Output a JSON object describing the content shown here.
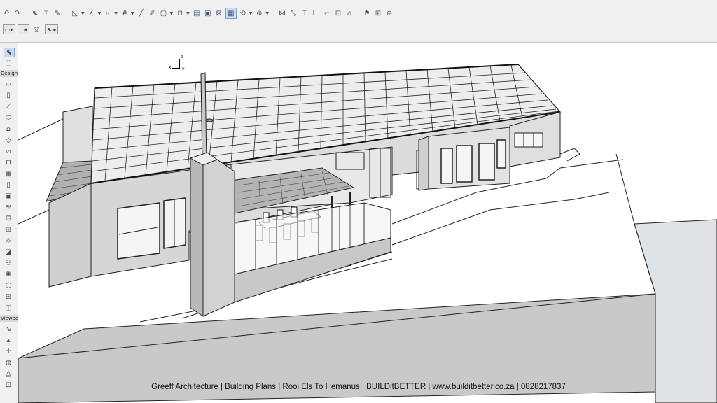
{
  "toolbox": {
    "design_label": "Design",
    "viewpoint_label": "Viewpoi"
  },
  "canvas": {
    "axis_x": "x",
    "axis_y": "y",
    "axis_z": "z"
  },
  "caption": "Greeff Architecture | Building Plans | Rooi Els To Hemanus | BUILDitBETTER | www.builditbetter.co.za | 0828217837",
  "icons": [
    "undo-icon",
    "redo-icon",
    "arrow-select-icon",
    "magic-wand-icon",
    "pencil-icon",
    "pointer-icon",
    "marquee-icon",
    "wall-icon",
    "column-icon",
    "beam-icon",
    "slab-icon",
    "roof-icon",
    "window-icon",
    "door-icon",
    "stair-icon",
    "railing-icon",
    "curtain-wall-icon",
    "object-icon",
    "lamp-icon",
    "zone-icon",
    "mesh-icon",
    "camera-icon"
  ]
}
